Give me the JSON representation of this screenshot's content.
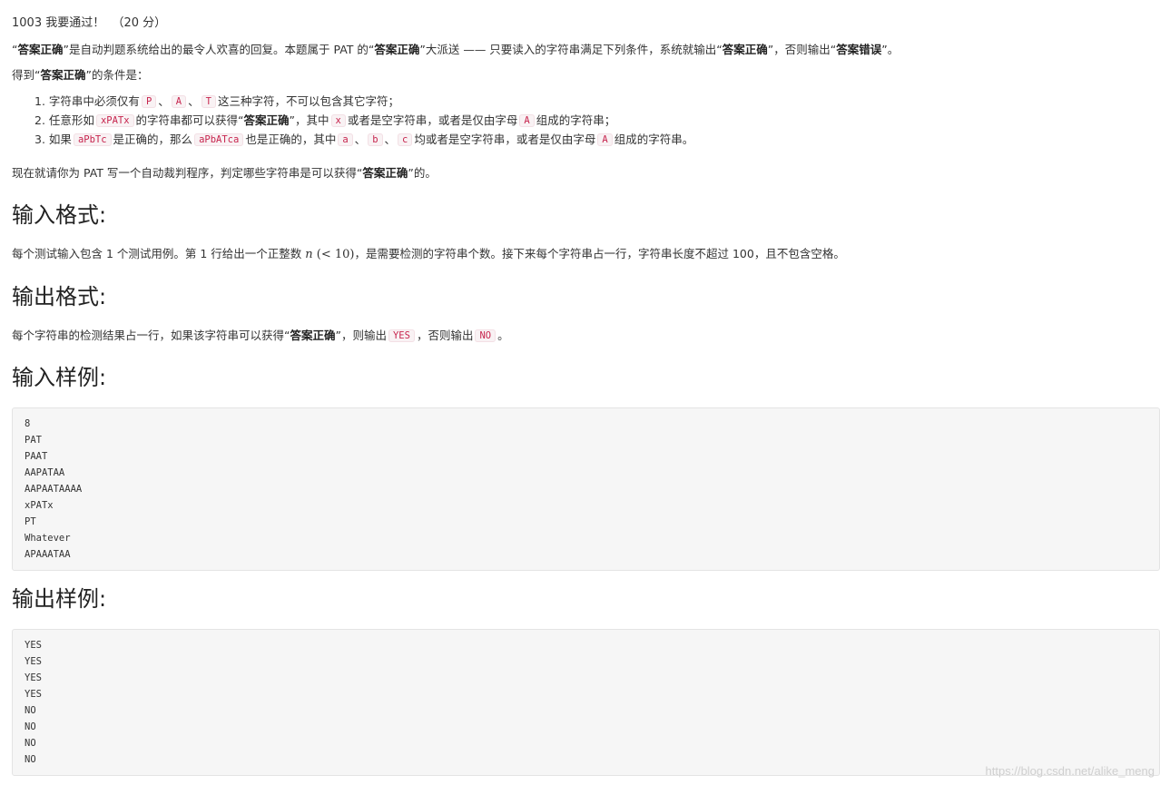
{
  "title": "1003 我要通过！  （20 分）",
  "intro": {
    "q1": "“",
    "b1": "答案正确",
    "t1": "”是自动判题系统给出的最令人欢喜的回复。本题属于 PAT 的“",
    "b2": "答案正确",
    "t2": "”大派送 —— 只要读入的字符串满足下列条件，系统就输出“",
    "b3": "答案正确",
    "t3": "”，否则输出“",
    "b4": "答案错误",
    "t4": "”。"
  },
  "cond_intro": {
    "pre": "得到“",
    "bold": "答案正确",
    "post": "”的条件是："
  },
  "conditions": [
    {
      "num": "1.",
      "t1": "字符串中必须仅有",
      "c1": "P",
      "s1": "、",
      "c2": "A",
      "s2": "、",
      "c3": "T",
      "t2": "这三种字符，不可以包含其它字符；"
    },
    {
      "num": "2.",
      "t1": "任意形如",
      "c1": "xPATx",
      "t2": "的字符串都可以获得“",
      "b1": "答案正确",
      "t3": "”，其中",
      "c2": "x",
      "t4": "或者是空字符串，或者是仅由字母",
      "c3": "A",
      "t5": "组成的字符串；"
    },
    {
      "num": "3.",
      "t1": "如果",
      "c1": "aPbTc",
      "t2": "是正确的，那么",
      "c2": "aPbATca",
      "t3": "也是正确的，其中",
      "c3": "a",
      "s1": "、",
      "c4": "b",
      "s2": "、",
      "c5": "c",
      "t4": "均或者是空字符串，或者是仅由字母",
      "c6": "A",
      "t5": "组成的字符串。"
    }
  ],
  "task": {
    "pre": "现在就请你为 PAT 写一个自动裁判程序，判定哪些字符串是可以获得“",
    "bold": "答案正确",
    "post": "”的。"
  },
  "sections": {
    "input_format": "输入格式:",
    "output_format": "输出格式:",
    "input_sample": "输入样例:",
    "output_sample": "输出样例:"
  },
  "input_desc": {
    "t1": "每个测试输入包含 1 个测试用例。第 1 行给出一个正整数 ",
    "var": "n",
    "math_rest": " (< 10)",
    "t2": "，是需要检测的字符串个数。接下来每个字符串占一行，字符串长度不超过 100，且不包含空格。"
  },
  "output_desc": {
    "t1": "每个字符串的检测结果占一行，如果该字符串可以获得“",
    "b1": "答案正确",
    "t2": "”，则输出",
    "c1": "YES",
    "t3": "，否则输出",
    "c2": "NO",
    "t4": "。"
  },
  "sample_input": [
    "8",
    "PAT",
    "PAAT",
    "AAPATAA",
    "AAPAATAAAA",
    "xPATx",
    "PT",
    "Whatever",
    "APAAATAA"
  ],
  "sample_output": [
    "YES",
    "YES",
    "YES",
    "YES",
    "NO",
    "NO",
    "NO",
    "NO"
  ],
  "watermark": "https://blog.csdn.net/alike_meng"
}
